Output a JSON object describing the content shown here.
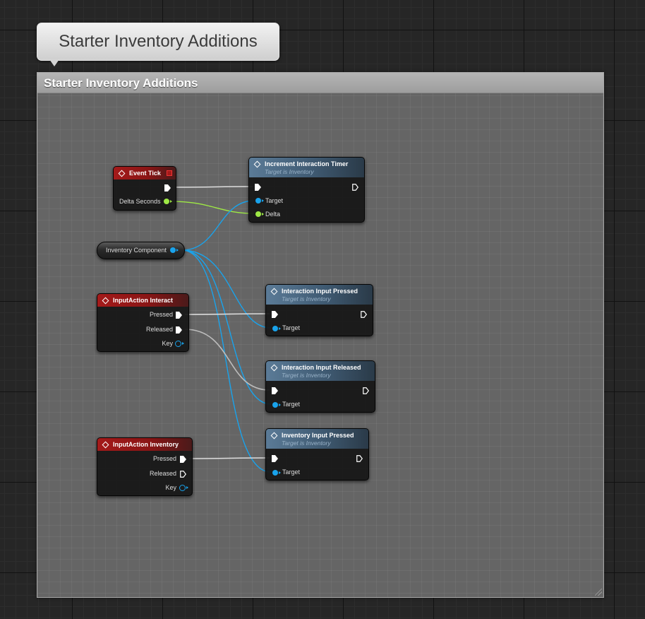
{
  "comment": {
    "bubble_text": "Starter Inventory Additions",
    "header_title": "Starter Inventory Additions"
  },
  "nodes": {
    "event_tick": {
      "title": "Event Tick",
      "output_delta": "Delta Seconds"
    },
    "increment_timer": {
      "title": "Increment Interaction Timer",
      "subtitle": "Target is Inventory",
      "input_target": "Target",
      "input_delta": "Delta"
    },
    "inventory_component": {
      "label": "Inventory Component"
    },
    "input_interact": {
      "title": "InputAction Interact",
      "pressed": "Pressed",
      "released": "Released",
      "key": "Key"
    },
    "interaction_pressed": {
      "title": "Interaction Input Pressed",
      "subtitle": "Target is Inventory",
      "input_target": "Target"
    },
    "interaction_released": {
      "title": "Interaction Input Released",
      "subtitle": "Target is Inventory",
      "input_target": "Target"
    },
    "input_inventory": {
      "title": "InputAction Inventory",
      "pressed": "Pressed",
      "released": "Released",
      "key": "Key"
    },
    "inventory_pressed": {
      "title": "Inventory Input Pressed",
      "subtitle": "Target is Inventory",
      "input_target": "Target"
    }
  },
  "colors": {
    "event_header": "#a41a1a",
    "function_header": "#5b7b97",
    "object_pin": "#19a3ec",
    "float_pin": "#9ee845",
    "exec_wire": "#ffffff"
  }
}
